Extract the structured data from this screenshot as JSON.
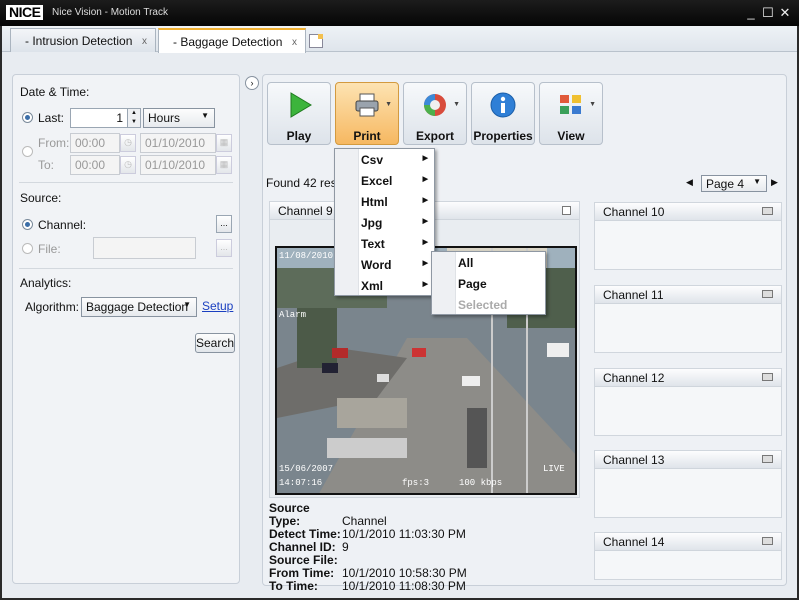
{
  "window": {
    "logo": "NICE",
    "title": "Nice Vision - Motion Track",
    "buttons": [
      "_",
      "☐",
      "✕"
    ]
  },
  "tabs": [
    {
      "label": "- Intrusion Detection",
      "close": "x"
    },
    {
      "label": "- Baggage Detection",
      "close": "x"
    }
  ],
  "left": {
    "date_time_label": "Date & Time:",
    "last_label": "Last:",
    "last_value": "1",
    "last_unit": "Hours",
    "from_label": "From:",
    "from_time": "00:00",
    "from_date": "01/10/2010",
    "to_label": "To:",
    "to_time": "00:00",
    "to_date": "01/10/2010",
    "source_label": "Source:",
    "channel_label": "Channel:",
    "file_label": "File:",
    "browse": "...",
    "analytics_label": "Analytics:",
    "algorithm_label": "Algorithm:",
    "algorithm_value": "Baggage Detection",
    "setup_link": "Setup",
    "search_button": "Search"
  },
  "toolbar": {
    "play": "Play",
    "print": "Print",
    "export": "Export",
    "properties": "Properties",
    "view": "View"
  },
  "results": {
    "found_text": "Found 42 resu",
    "page_value": "Page 4",
    "prev": "◀",
    "next": "▶"
  },
  "channels": {
    "main": "Channel 9",
    "side": [
      "Channel 10",
      "Channel 11",
      "Channel 12",
      "Channel 13",
      "Channel 14"
    ]
  },
  "video_overlay": {
    "top": "11/08/2010",
    "alarm": "Alarm",
    "bottom_date": "15/06/2007",
    "bottom_time": "14:07:16",
    "fps": "fps:3",
    "kbps": "100 kbps",
    "live": "LIVE"
  },
  "details": [
    {
      "key": "Source Type:",
      "value": "Channel"
    },
    {
      "key": "Detect Time:",
      "value": "10/1/2010 11:03:30 PM"
    },
    {
      "key": "Channel ID:",
      "value": "9"
    },
    {
      "key": "Source File:",
      "value": ""
    },
    {
      "key": "From Time:",
      "value": "10/1/2010 10:58:30 PM"
    },
    {
      "key": "To Time:",
      "value": "10/1/2010 11:08:30 PM"
    }
  ],
  "print_menu": {
    "items": [
      "Csv",
      "Excel",
      "Html",
      "Jpg",
      "Text",
      "Word",
      "Xml"
    ],
    "word_submenu": [
      {
        "label": "All",
        "enabled": true
      },
      {
        "label": "Page",
        "enabled": true
      },
      {
        "label": "Selected",
        "enabled": false
      }
    ]
  },
  "colors": {
    "accent_tab": "#f0b030",
    "print_active": "#f6b861",
    "link": "#1a3fc0"
  }
}
